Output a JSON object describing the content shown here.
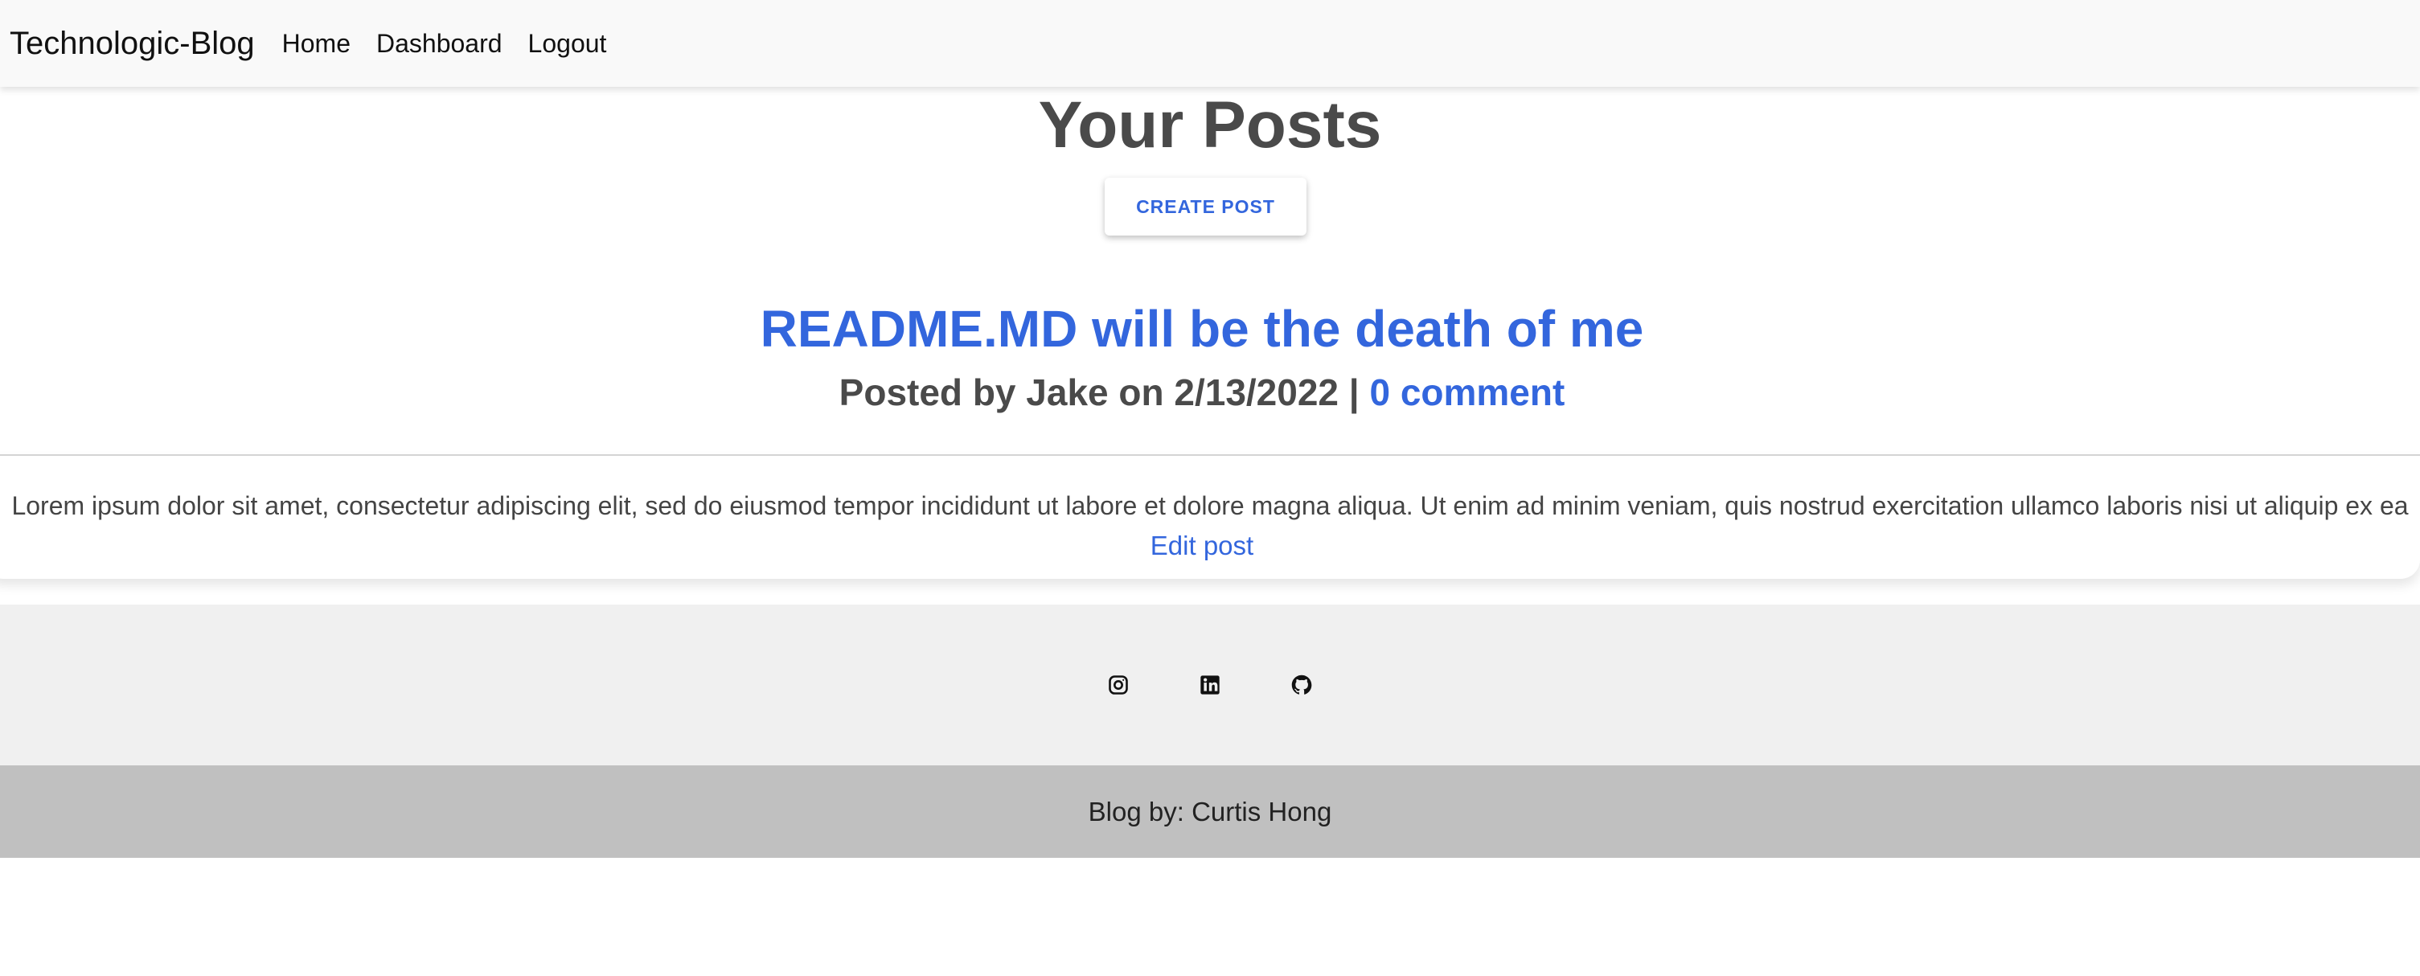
{
  "navbar": {
    "brand": "Technologic-Blog",
    "links": [
      "Home",
      "Dashboard",
      "Logout"
    ]
  },
  "main": {
    "title": "Your Posts",
    "create_button": "CREATE POST"
  },
  "post": {
    "title": "README.MD will be the death of me",
    "meta_prefix": "Posted by Jake on 2/13/2022 | ",
    "comment_link": "0 comment",
    "body": "Lorem ipsum dolor sit amet, consectetur adipiscing elit, sed do eiusmod tempor incididunt ut labore et dolore magna aliqua. Ut enim ad minim veniam, quis nostrud exercitation ullamco laboris nisi ut aliquip ex ea",
    "edit_link": "Edit post"
  },
  "footer": {
    "icons": [
      "instagram-icon",
      "linkedin-icon",
      "github-icon"
    ],
    "credit": "Blog by: Curtis Hong"
  },
  "colors": {
    "accent": "#3366dd",
    "title": "#4a4a4a",
    "navbar_bg": "#f9f9f9",
    "footer_top_bg": "#f0f0f0",
    "footer_bottom_bg": "#c0c0c0"
  }
}
